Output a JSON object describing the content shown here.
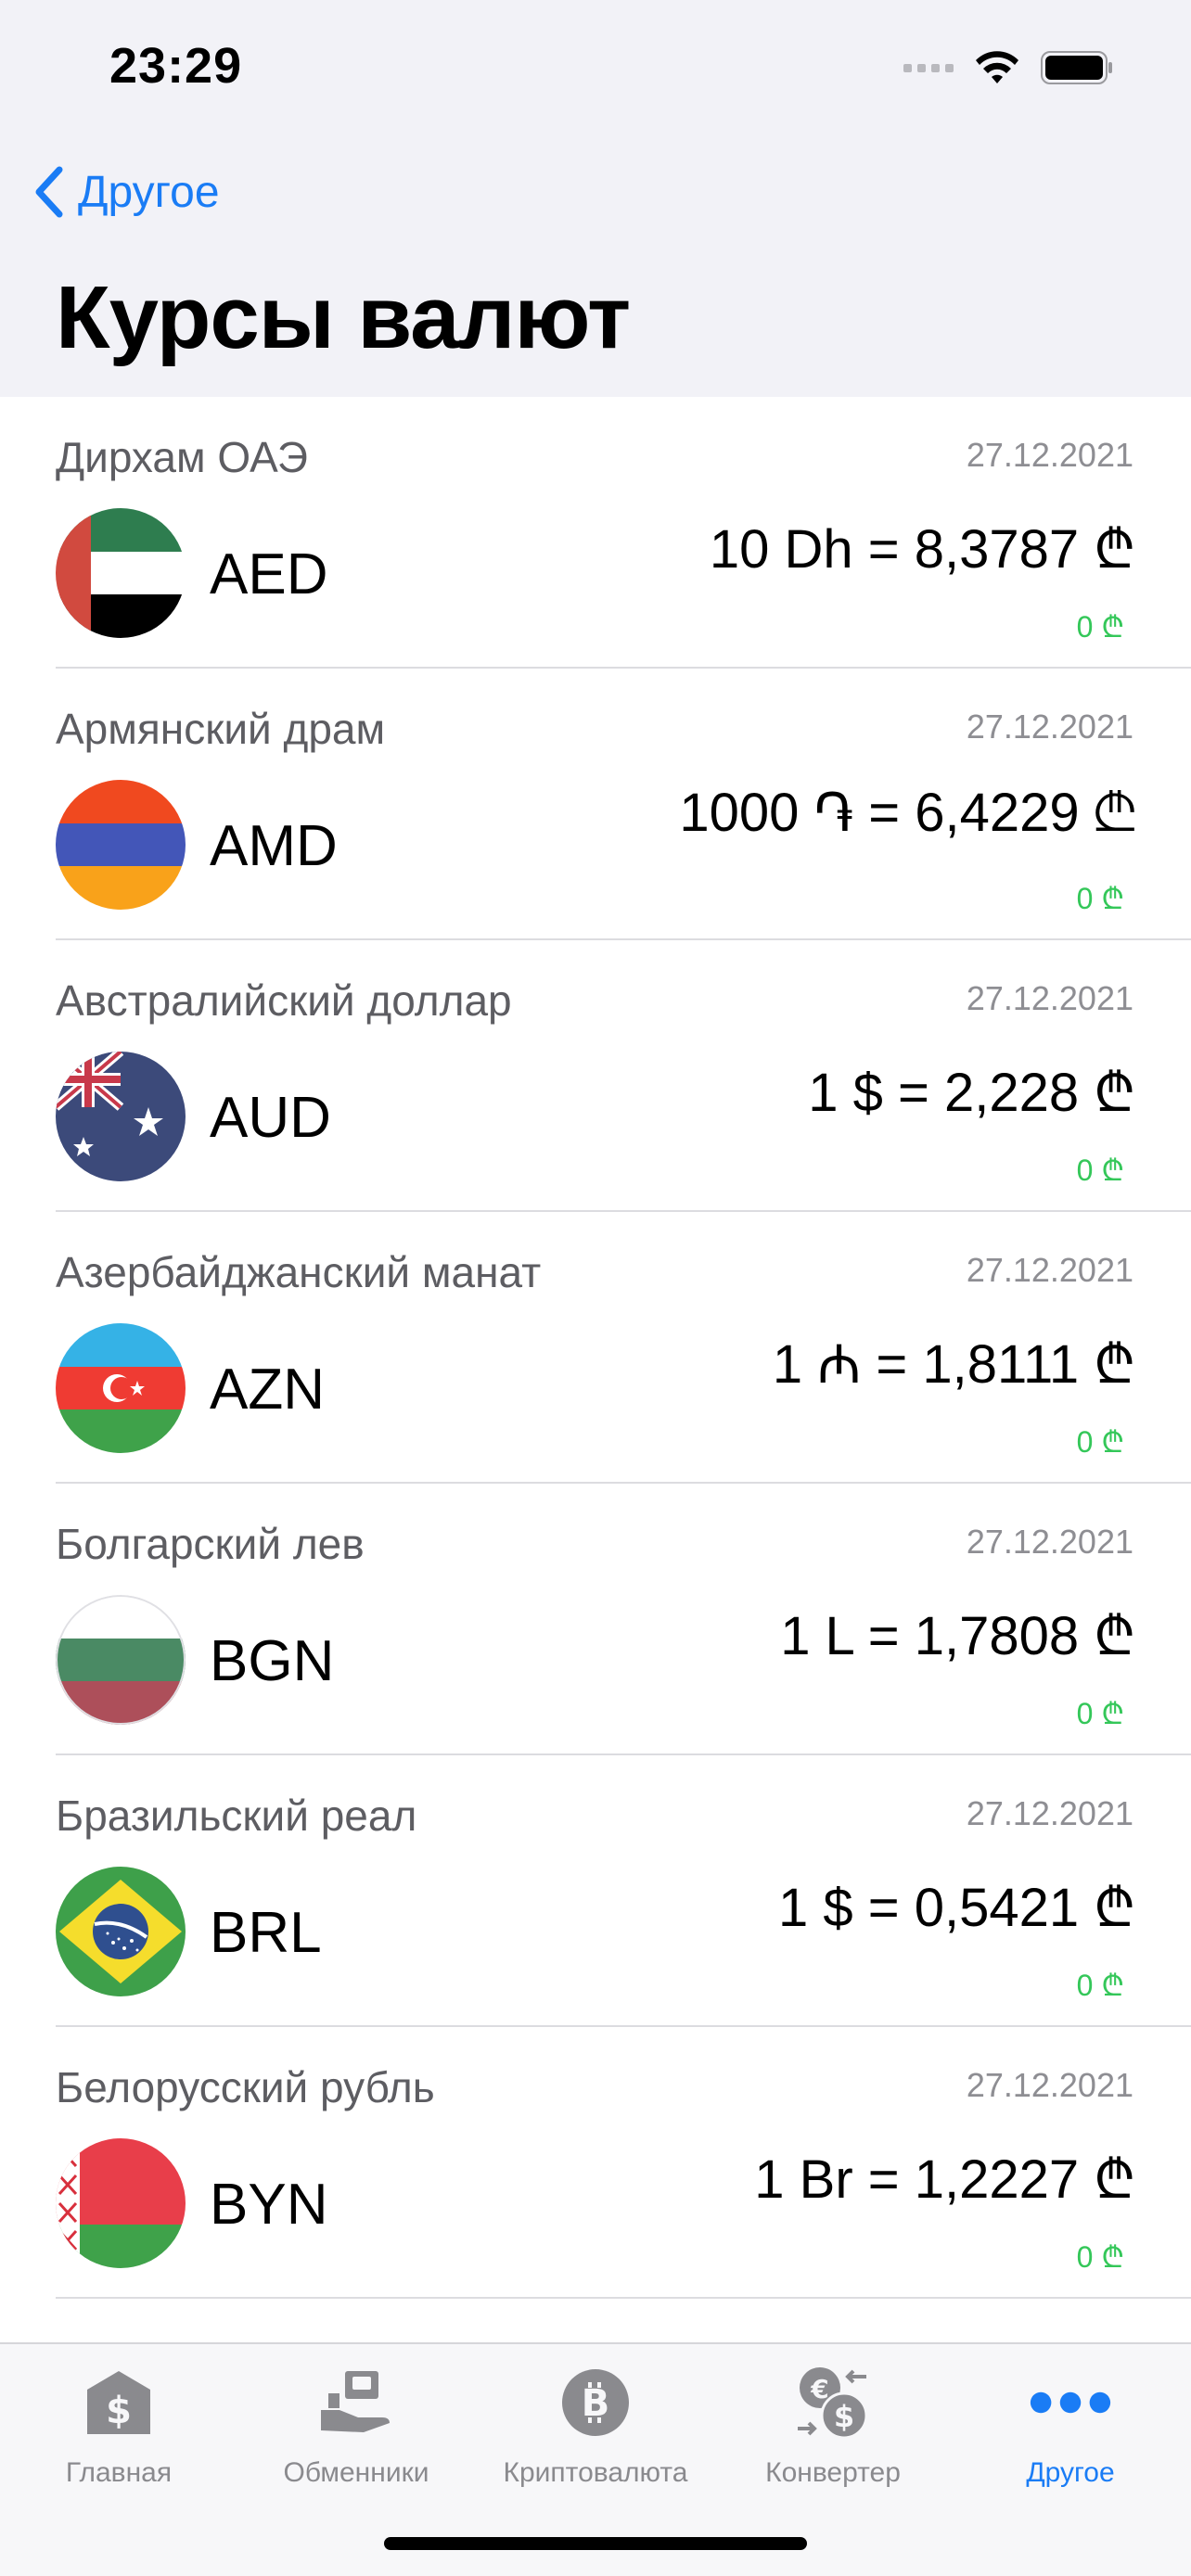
{
  "status_bar": {
    "time": "23:29"
  },
  "nav": {
    "back_label": "Другое",
    "title": "Курсы валют"
  },
  "rows": [
    {
      "name": "Дирхам ОАЭ",
      "date": "27.12.2021",
      "code": "AED",
      "rate": "10 Dh = 8,3787 ₾",
      "change": "0 ₾",
      "flag": "ae-flag-icon"
    },
    {
      "name": "Армянский драм",
      "date": "27.12.2021",
      "code": "AMD",
      "rate": "1000 ֏ = 6,4229 ₾",
      "change": "0 ₾",
      "flag": "am-flag-icon"
    },
    {
      "name": "Австралийский доллар",
      "date": "27.12.2021",
      "code": "AUD",
      "rate": "1 $ = 2,228 ₾",
      "change": "0 ₾",
      "flag": "au-flag-icon"
    },
    {
      "name": "Азербайджанский манат",
      "date": "27.12.2021",
      "code": "AZN",
      "rate": "1 ₼ = 1,8111 ₾",
      "change": "0 ₾",
      "flag": "az-flag-icon"
    },
    {
      "name": "Болгарский лев",
      "date": "27.12.2021",
      "code": "BGN",
      "rate": "1 L = 1,7808 ₾",
      "change": "0 ₾",
      "flag": "bg-flag-icon"
    },
    {
      "name": "Бразильский реал",
      "date": "27.12.2021",
      "code": "BRL",
      "rate": "1 $ = 0,5421 ₾",
      "change": "0 ₾",
      "flag": "br-flag-icon"
    },
    {
      "name": "Белорусский рубль",
      "date": "27.12.2021",
      "code": "BYN",
      "rate": "1 Br = 1,2227 ₾",
      "change": "0 ₾",
      "flag": "by-flag-icon"
    }
  ],
  "tabs": [
    {
      "label": "Главная",
      "icon": "bank-dollar-icon",
      "active": false
    },
    {
      "label": "Обменники",
      "icon": "exchange-office-icon",
      "active": false
    },
    {
      "label": "Криптовалюта",
      "icon": "bitcoin-icon",
      "active": false
    },
    {
      "label": "Конвертер",
      "icon": "currency-convert-icon",
      "active": false
    },
    {
      "label": "Другое",
      "icon": "more-dots-icon",
      "active": true
    }
  ],
  "colors": {
    "accent": "#1a7cf5",
    "positive": "#34c759",
    "header_bg": "#f2f2f7"
  }
}
